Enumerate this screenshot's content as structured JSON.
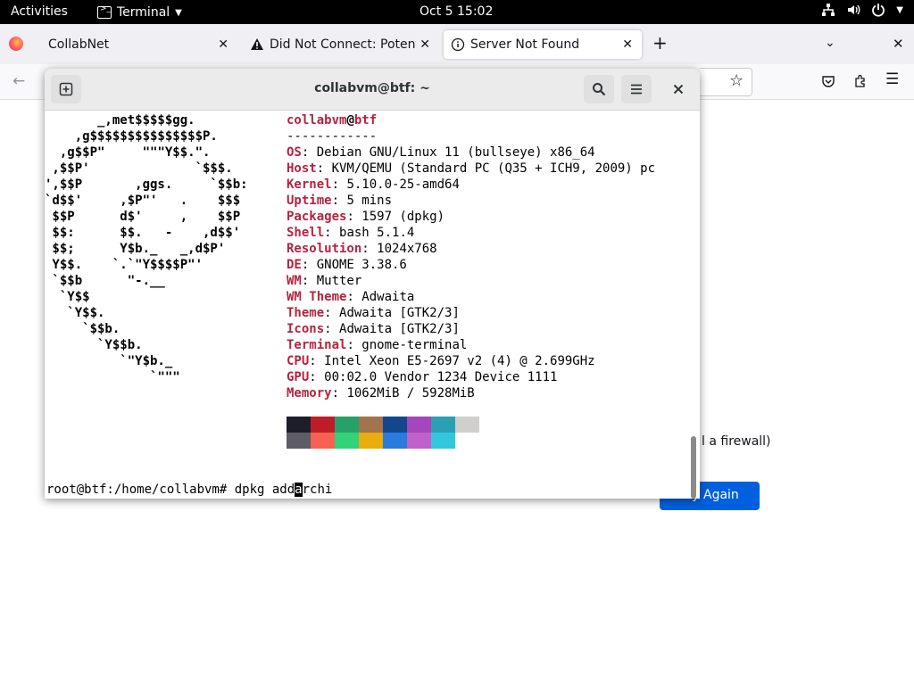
{
  "topbar": {
    "activities": "Activities",
    "app_name": "Terminal",
    "clock": "Oct 5  15:02"
  },
  "firefox": {
    "tabs": [
      {
        "title": "CollabNet"
      },
      {
        "title": "Did Not Connect: Potentia"
      },
      {
        "title": "Server Not Found"
      }
    ],
    "page": {
      "partial_text": "l a firewall)",
      "try_again_partial": "Try Again"
    }
  },
  "terminal": {
    "title": "collabvm@btf: ~",
    "logo_lines": [
      "       _,met$$$$$gg.",
      "    ,g$$$$$$$$$$$$$$$P.",
      "  ,g$$P\"     \"\"\"Y$$.\".",
      " ,$$P'              `$$$.",
      "',$$P       ,ggs.     `$$b:",
      "`d$$'     ,$P\"'   .    $$$",
      " $$P      d$'     ,    $$P",
      " $$:      $$.   -    ,d$$'",
      " $$;      Y$b._   _,d$P'",
      " Y$$.    `.`\"Y$$$$P\"'",
      " `$$b      \"-.__",
      "  `Y$$",
      "   `Y$$.",
      "     `$$b.",
      "       `Y$$b.",
      "          `\"Y$b._",
      "              `\"\"\""
    ],
    "user_host": {
      "user": "collabvm",
      "at": "@",
      "host": "btf"
    },
    "separator": "------------",
    "info": [
      {
        "label": "OS",
        "value": "Debian GNU/Linux 11 (bullseye) x86_64"
      },
      {
        "label": "Host",
        "value": "KVM/QEMU (Standard PC (Q35 + ICH9, 2009) pc"
      },
      {
        "label": "Kernel",
        "value": "5.10.0-25-amd64"
      },
      {
        "label": "Uptime",
        "value": "5 mins"
      },
      {
        "label": "Packages",
        "value": "1597 (dpkg)"
      },
      {
        "label": "Shell",
        "value": "bash 5.1.4"
      },
      {
        "label": "Resolution",
        "value": "1024x768"
      },
      {
        "label": "DE",
        "value": "GNOME 3.38.6"
      },
      {
        "label": "WM",
        "value": "Mutter"
      },
      {
        "label": "WM Theme",
        "value": "Adwaita"
      },
      {
        "label": "Theme",
        "value": "Adwaita [GTK2/3]"
      },
      {
        "label": "Icons",
        "value": "Adwaita [GTK2/3]"
      },
      {
        "label": "Terminal",
        "value": "gnome-terminal"
      },
      {
        "label": "CPU",
        "value": "Intel Xeon E5-2697 v2 (4) @ 2.699GHz"
      },
      {
        "label": "GPU",
        "value": "00:02.0 Vendor 1234 Device 1111"
      },
      {
        "label": "Memory",
        "value": "1062MiB / 5928MiB"
      }
    ],
    "palette_row1": [
      "#1e1e2a",
      "#c01c28",
      "#26a269",
      "#a2734c",
      "#12488b",
      "#a347ba",
      "#2aa1b3",
      "#d0cfcc"
    ],
    "palette_row2": [
      "#5e5c64",
      "#f66151",
      "#33d17a",
      "#e9ad0c",
      "#2a7bde",
      "#c061cb",
      "#33c7de"
    ],
    "prompt": {
      "ps1": "root@btf:/home/collabvm# ",
      "cmd_before_cursor": "dpkg add",
      "cursor_char": "a",
      "cmd_after_cursor": "rchi"
    }
  },
  "colors": {
    "label_red": "#b3243e",
    "firefox_blue": "#0060df"
  }
}
